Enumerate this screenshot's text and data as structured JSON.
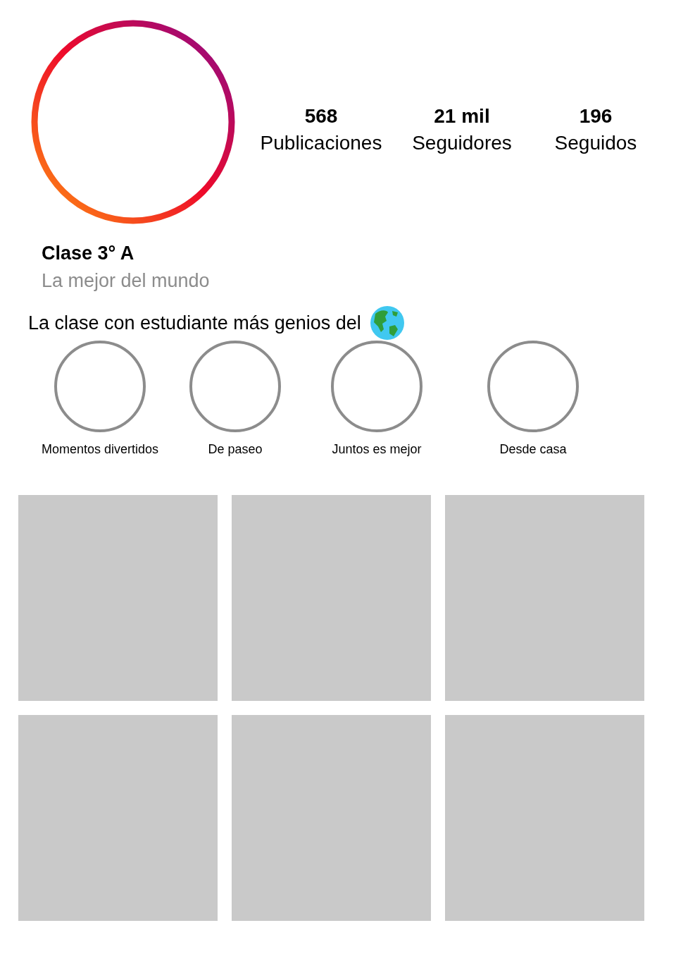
{
  "profile": {
    "avatar": {
      "kind": "gradient-ring"
    },
    "stats": [
      {
        "value": "568",
        "label": "Publicaciones"
      },
      {
        "value": "21 mil",
        "label": "Seguidores"
      },
      {
        "value": "196",
        "label": "Seguidos"
      }
    ],
    "name": "Clase 3° A",
    "subtitle": "La mejor del mundo",
    "bio": "La clase con estudiante más genios del"
  },
  "highlights": [
    {
      "label": "Momentos divertidos"
    },
    {
      "label": "De paseo"
    },
    {
      "label": "Juntos es mejor"
    },
    {
      "label": "Desde casa"
    }
  ],
  "posts": [
    {
      "kind": "placeholder"
    },
    {
      "kind": "placeholder"
    },
    {
      "kind": "placeholder"
    },
    {
      "kind": "placeholder"
    },
    {
      "kind": "placeholder"
    },
    {
      "kind": "placeholder"
    }
  ]
}
